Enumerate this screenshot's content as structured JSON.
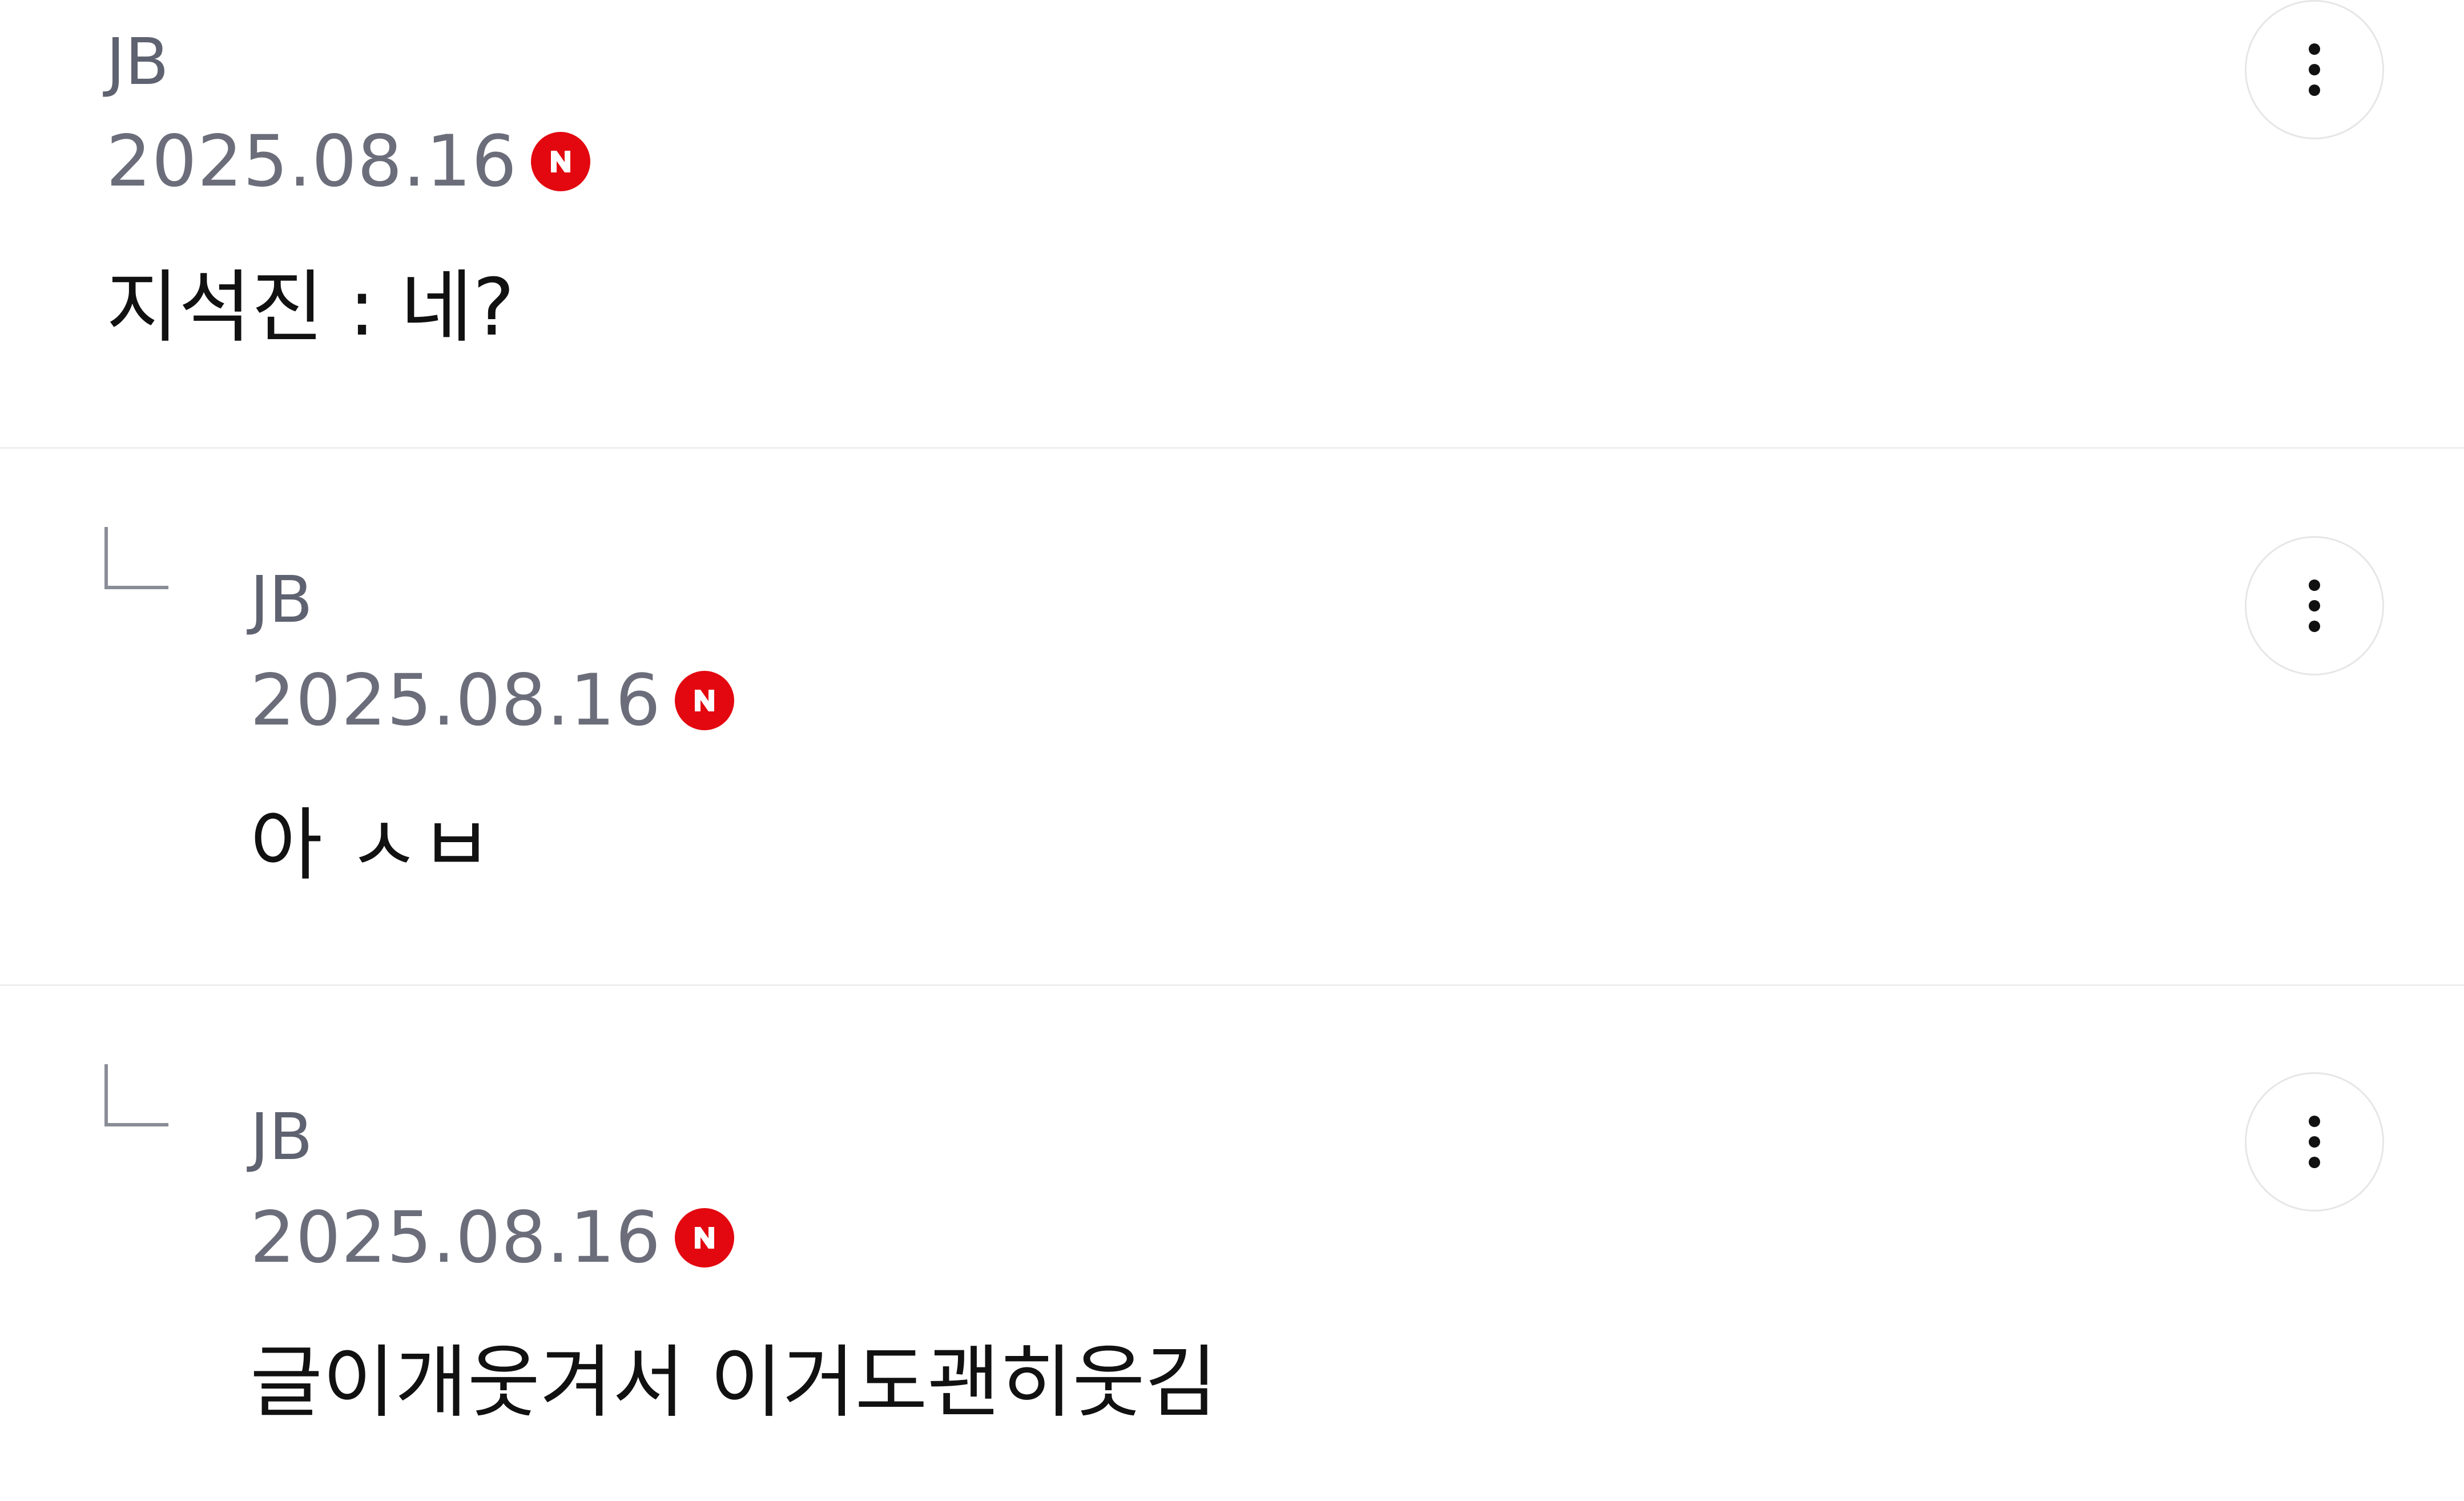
{
  "comments": [
    {
      "author": "JB",
      "date": "2025.08.16",
      "badge_icon": "naver-n-icon",
      "text": "지석진 : 네?",
      "is_reply": false,
      "more_icon": "more-vertical-icon"
    },
    {
      "author": "JB",
      "date": "2025.08.16",
      "badge_icon": "naver-n-icon",
      "text": "아 ㅅㅂ",
      "is_reply": true,
      "reply_icon": "reply-arrow-icon",
      "more_icon": "more-vertical-icon"
    },
    {
      "author": "JB",
      "date": "2025.08.16",
      "badge_icon": "naver-n-icon",
      "text": "글이개웃겨서 이거도괜히웃김",
      "is_reply": true,
      "reply_icon": "reply-arrow-icon",
      "more_icon": "more-vertical-icon"
    }
  ],
  "colors": {
    "badge": "#e3070f",
    "author_text": "#5f6270",
    "date_text": "#6b6e7a",
    "body_text": "#111111",
    "divider": "#eeeeee"
  }
}
